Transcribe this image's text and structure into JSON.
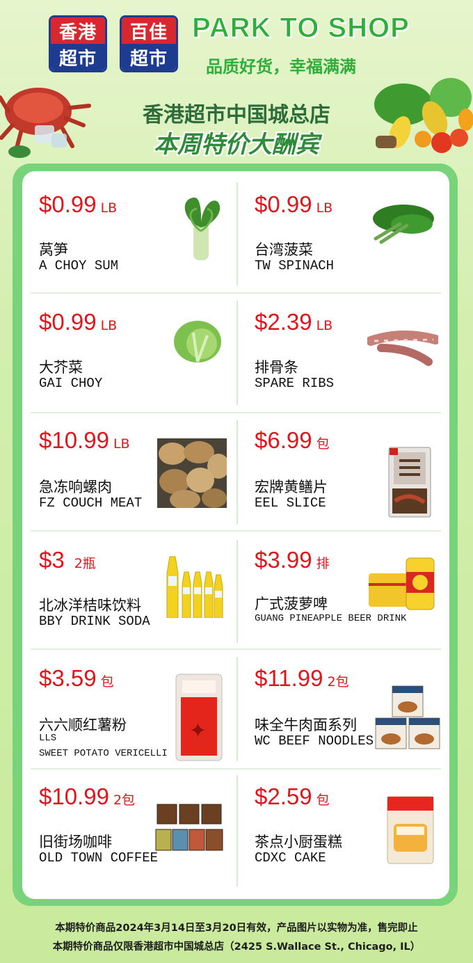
{
  "header": {
    "logo_left": {
      "top": "香港",
      "bottom": "超市"
    },
    "logo_right": {
      "top": "百佳",
      "bottom": "超市"
    },
    "brand": "PARK TO SHOP",
    "slogan": "品质好货，幸福满满",
    "store_name": "香港超市中国城总店",
    "headline": "本周特价大酬宾"
  },
  "products": [
    {
      "price": "$0.99",
      "unit": "LB",
      "cn": "莴笋",
      "en": "A CHOY SUM",
      "icon": "lettuce-stem-icon"
    },
    {
      "price": "$0.99",
      "unit": "LB",
      "cn": "台湾菠菜",
      "en": "TW SPINACH",
      "icon": "spinach-icon"
    },
    {
      "price": "$0.99",
      "unit": "LB",
      "cn": "大芥菜",
      "en": "GAI CHOY",
      "icon": "mustard-green-icon"
    },
    {
      "price": "$2.39",
      "unit": "LB",
      "cn": "排骨条",
      "en": "SPARE RIBS",
      "icon": "ribs-icon"
    },
    {
      "price": "$10.99",
      "unit": "LB",
      "cn": "急冻响螺肉",
      "en": "FZ COUCH MEAT",
      "icon": "conch-meat-icon"
    },
    {
      "price": "$6.99",
      "unit": "包",
      "cn": "宏牌黄鳝片",
      "en": "EEL SLICE",
      "icon": "eel-package-icon"
    },
    {
      "price": "$3",
      "unit": "2瓶",
      "cn": "北冰洋桔味饮料",
      "en": "BBY DRINK SODA",
      "icon": "soda-bottles-icon"
    },
    {
      "price": "$3.99",
      "unit": "排",
      "cn": "广式菠萝啤",
      "en": "GUANG PINEAPPLE BEER DRINK",
      "icon": "beer-cans-icon"
    },
    {
      "price": "$3.59",
      "unit": "包",
      "cn": "六六顺红薯粉",
      "en": "LLS",
      "en2": "SWEET POTATO VERICELLI",
      "icon": "noodle-bag-icon"
    },
    {
      "price": "$11.99",
      "unit": "2包",
      "cn": "味全牛肉面系列",
      "en": "WC BEEF NOODLES",
      "icon": "noodle-boxes-icon"
    },
    {
      "price": "$10.99",
      "unit": "2包",
      "cn": "旧街场咖啡",
      "en": "OLD TOWN COFFEE",
      "icon": "coffee-boxes-icon"
    },
    {
      "price": "$2.59",
      "unit": "包",
      "cn": "茶点小厨蛋糕",
      "en": "CDXC CAKE",
      "icon": "cake-package-icon"
    }
  ],
  "footer": {
    "line1": "本期特价商品2024年3月14日至3月20日有效，产品图片以实物为准，售完即止",
    "line2": "本期特价商品仅限香港超市中国城总店（2425 S.Wallace St., Chicago, IL）"
  },
  "colors": {
    "brand_green": "#2fae3c",
    "price_red": "#e0161d",
    "panel_green": "#78d37a",
    "logo_blue": "#1e3c8f",
    "logo_red": "#d7272f"
  }
}
